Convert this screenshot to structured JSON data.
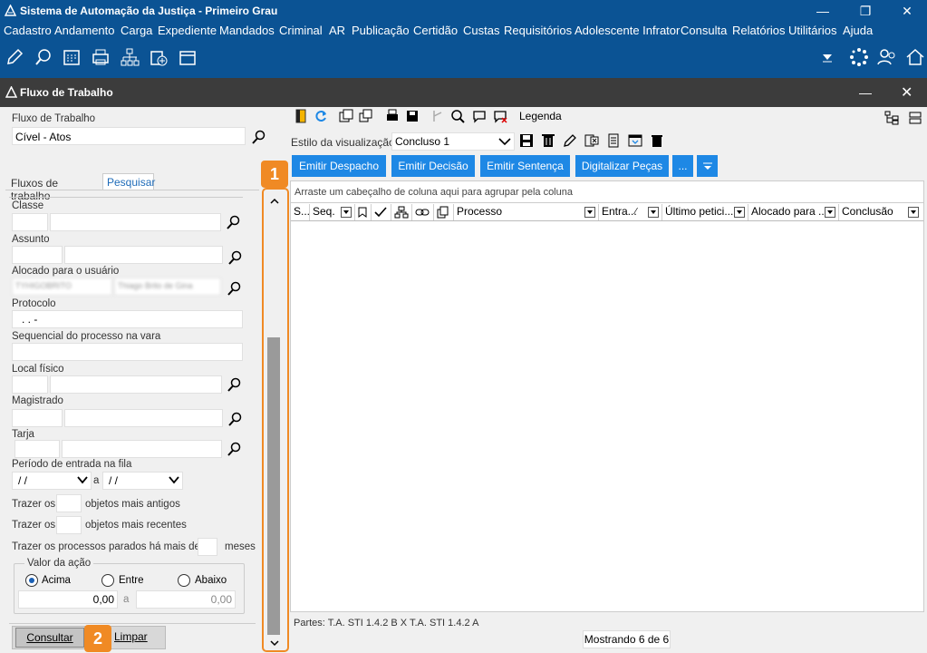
{
  "app": {
    "title": "Sistema de Automação da Justiça - Primeiro Grau",
    "menu": [
      "Cadastro",
      "Andamento",
      "Carga",
      "Expediente",
      "Mandados",
      "Criminal",
      "AR",
      "Publicação",
      "Certidão",
      "Custas",
      "Requisitórios",
      "Adolescente Infrator",
      "Consulta",
      "Relatórios",
      "Utilitários",
      "Ajuda"
    ]
  },
  "window": {
    "title": "Fluxo de Trabalho"
  },
  "left": {
    "flow_label": "Fluxo de Trabalho",
    "flow_value": "Cível - Atos",
    "tabs": [
      "Fluxos de trabalho",
      "Pesquisar"
    ],
    "classe_label": "Classe",
    "assunto_label": "Assunto",
    "alocado_label": "Alocado para o usuário",
    "alocado_code": "TYHIGOBRITO",
    "alocado_name": "Thiago Brito de Gina",
    "protocolo_label": "Protocolo",
    "protocolo_value": ". . -",
    "sequencial_label": "Sequencial do processo na vara",
    "local_label": "Local físico",
    "magistrado_label": "Magistrado",
    "tarja_label": "Tarja",
    "periodo_label": "Período de entrada na fila",
    "date_from": " / /",
    "date_sep": "a",
    "date_to": " / /",
    "trazer_os": "Trazer os",
    "antigos": "objetos mais antigos",
    "recentes": "objetos mais recentes",
    "parados": "Trazer os processos parados há mais de",
    "meses": "meses",
    "valor_label": "Valor da ação",
    "radio_acima": "Acima",
    "radio_entre": "Entre",
    "radio_abaixo": "Abaixo",
    "valor1": "0,00",
    "valor_sep": "a",
    "valor2": "0,00",
    "consultar": "Consultar",
    "limpar": "Limpar"
  },
  "right": {
    "legenda": "Legenda",
    "estilo_label": "Estilo da visualização",
    "estilo_value": "Concluso 1",
    "buttons": [
      "Emitir Despacho",
      "Emitir Decisão",
      "Emitir Sentença",
      "Digitalizar Peças",
      "..."
    ],
    "group_hint": "Arraste um cabeçalho de coluna aqui para agrupar pela coluna",
    "columns": [
      "S...",
      "Seq.",
      "Processo",
      "Entra...",
      "Último petici...",
      "Alocado para ...",
      "Conclusão"
    ],
    "partes": "Partes: T.A. STI 1.4.2 B  X  T.A. STI 1.4.2 A",
    "status": "Mostrando 6 de 6"
  },
  "badges": [
    "1",
    "2"
  ],
  "colors": {
    "titlebar": "#0b5394",
    "accent_button": "#1e88e5",
    "highlight": "#f08a24"
  }
}
